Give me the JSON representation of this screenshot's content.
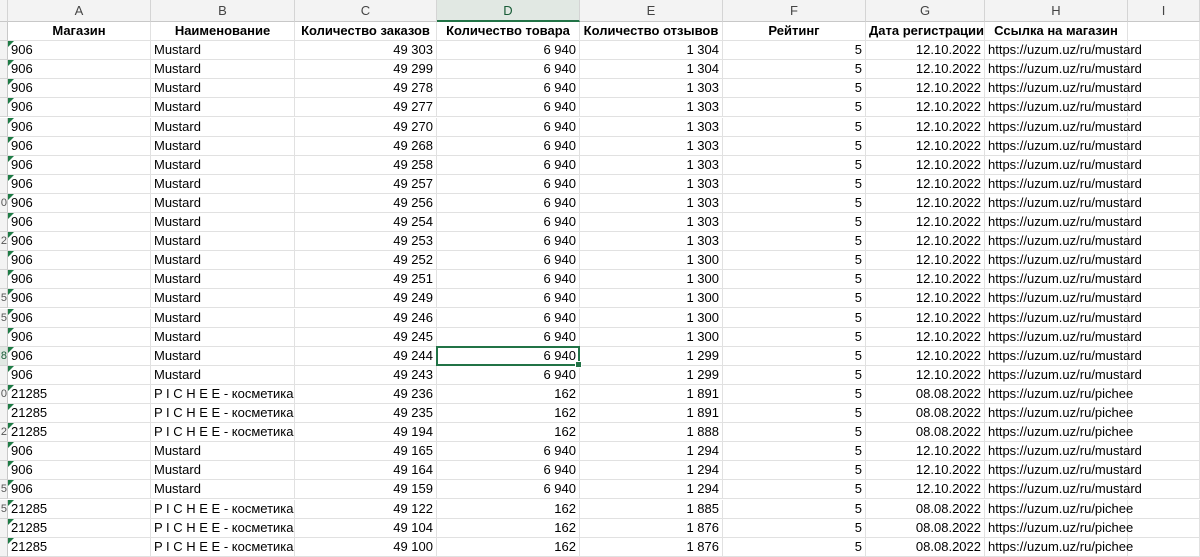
{
  "sheet": {
    "columns": [
      "A",
      "B",
      "C",
      "D",
      "E",
      "F",
      "G",
      "H",
      "I"
    ],
    "selected_column": "D",
    "active_row_index": 17,
    "headers": [
      "Магазин",
      "Наименование",
      "Количество заказов",
      "Количество товара",
      "Количество отзывов",
      "Рейтинг",
      "Дата регистрации",
      "Ссылка на магазин"
    ],
    "row_numbers": [
      "",
      "",
      "",
      "",
      "",
      "",
      "",
      "",
      "",
      "0",
      "",
      "2",
      "",
      "",
      "5",
      "5",
      "",
      "8",
      "",
      "0",
      "",
      "2",
      "",
      "",
      "5",
      "5",
      "",
      ""
    ],
    "rows": [
      [
        "906",
        "Mustard",
        "49 303",
        "6 940",
        "1 304",
        "5",
        "12.10.2022",
        "https://uzum.uz/ru/mustard"
      ],
      [
        "906",
        "Mustard",
        "49 299",
        "6 940",
        "1 304",
        "5",
        "12.10.2022",
        "https://uzum.uz/ru/mustard"
      ],
      [
        "906",
        "Mustard",
        "49 278",
        "6 940",
        "1 303",
        "5",
        "12.10.2022",
        "https://uzum.uz/ru/mustard"
      ],
      [
        "906",
        "Mustard",
        "49 277",
        "6 940",
        "1 303",
        "5",
        "12.10.2022",
        "https://uzum.uz/ru/mustard"
      ],
      [
        "906",
        "Mustard",
        "49 270",
        "6 940",
        "1 303",
        "5",
        "12.10.2022",
        "https://uzum.uz/ru/mustard"
      ],
      [
        "906",
        "Mustard",
        "49 268",
        "6 940",
        "1 303",
        "5",
        "12.10.2022",
        "https://uzum.uz/ru/mustard"
      ],
      [
        "906",
        "Mustard",
        "49 258",
        "6 940",
        "1 303",
        "5",
        "12.10.2022",
        "https://uzum.uz/ru/mustard"
      ],
      [
        "906",
        "Mustard",
        "49 257",
        "6 940",
        "1 303",
        "5",
        "12.10.2022",
        "https://uzum.uz/ru/mustard"
      ],
      [
        "906",
        "Mustard",
        "49 256",
        "6 940",
        "1 303",
        "5",
        "12.10.2022",
        "https://uzum.uz/ru/mustard"
      ],
      [
        "906",
        "Mustard",
        "49 254",
        "6 940",
        "1 303",
        "5",
        "12.10.2022",
        "https://uzum.uz/ru/mustard"
      ],
      [
        "906",
        "Mustard",
        "49 253",
        "6 940",
        "1 303",
        "5",
        "12.10.2022",
        "https://uzum.uz/ru/mustard"
      ],
      [
        "906",
        "Mustard",
        "49 252",
        "6 940",
        "1 300",
        "5",
        "12.10.2022",
        "https://uzum.uz/ru/mustard"
      ],
      [
        "906",
        "Mustard",
        "49 251",
        "6 940",
        "1 300",
        "5",
        "12.10.2022",
        "https://uzum.uz/ru/mustard"
      ],
      [
        "906",
        "Mustard",
        "49 249",
        "6 940",
        "1 300",
        "5",
        "12.10.2022",
        "https://uzum.uz/ru/mustard"
      ],
      [
        "906",
        "Mustard",
        "49 246",
        "6 940",
        "1 300",
        "5",
        "12.10.2022",
        "https://uzum.uz/ru/mustard"
      ],
      [
        "906",
        "Mustard",
        "49 245",
        "6 940",
        "1 300",
        "5",
        "12.10.2022",
        "https://uzum.uz/ru/mustard"
      ],
      [
        "906",
        "Mustard",
        "49 244",
        "6 940",
        "1 299",
        "5",
        "12.10.2022",
        "https://uzum.uz/ru/mustard"
      ],
      [
        "906",
        "Mustard",
        "49 243",
        "6 940",
        "1 299",
        "5",
        "12.10.2022",
        "https://uzum.uz/ru/mustard"
      ],
      [
        "21285",
        "P I C H E E - косметика и",
        "49 236",
        "162",
        "1 891",
        "5",
        "08.08.2022",
        "https://uzum.uz/ru/pichee"
      ],
      [
        "21285",
        "P I C H E E - косметика и",
        "49 235",
        "162",
        "1 891",
        "5",
        "08.08.2022",
        "https://uzum.uz/ru/pichee"
      ],
      [
        "21285",
        "P I C H E E - косметика и",
        "49 194",
        "162",
        "1 888",
        "5",
        "08.08.2022",
        "https://uzum.uz/ru/pichee"
      ],
      [
        "906",
        "Mustard",
        "49 165",
        "6 940",
        "1 294",
        "5",
        "12.10.2022",
        "https://uzum.uz/ru/mustard"
      ],
      [
        "906",
        "Mustard",
        "49 164",
        "6 940",
        "1 294",
        "5",
        "12.10.2022",
        "https://uzum.uz/ru/mustard"
      ],
      [
        "906",
        "Mustard",
        "49 159",
        "6 940",
        "1 294",
        "5",
        "12.10.2022",
        "https://uzum.uz/ru/mustard"
      ],
      [
        "21285",
        "P I C H E E - косметика и",
        "49 122",
        "162",
        "1 885",
        "5",
        "08.08.2022",
        "https://uzum.uz/ru/pichee"
      ],
      [
        "21285",
        "P I C H E E - косметика и",
        "49 104",
        "162",
        "1 876",
        "5",
        "08.08.2022",
        "https://uzum.uz/ru/pichee"
      ],
      [
        "21285",
        "P I C H E E - косметика и",
        "49 100",
        "162",
        "1 876",
        "5",
        "08.08.2022",
        "https://uzum.uz/ru/pichee"
      ]
    ]
  }
}
